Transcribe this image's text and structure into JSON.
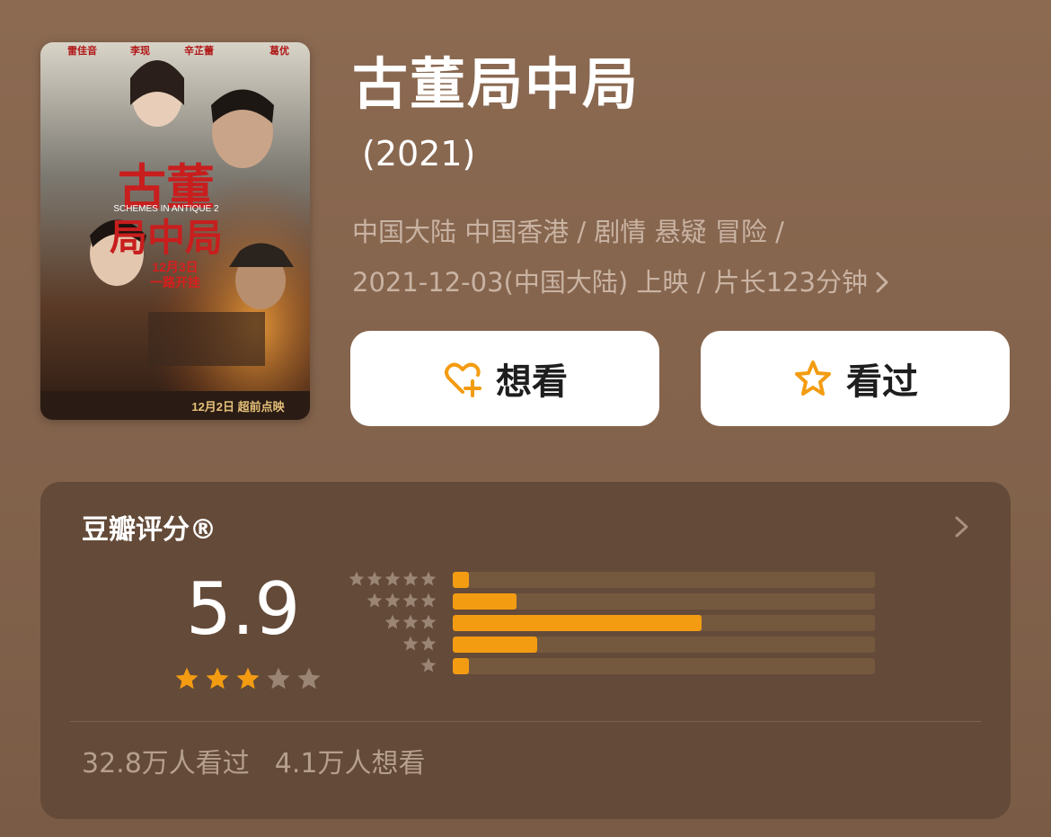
{
  "movie": {
    "title": "古董局中局",
    "year": "(2021)",
    "meta_line1": "中国大陆 中国香港 / 剧情 悬疑 冒险 /",
    "meta_line2": "2021-12-03(中国大陆) 上映 / 片长123分钟",
    "poster": {
      "title_text": "古董局中局",
      "english_subtitle": "SCHEMES IN ANTIQUE",
      "cast": [
        "雷佳音",
        "李现",
        "辛芷蕾",
        "葛优"
      ],
      "release_note": "12月3日 一路开挂",
      "preview_note": "12月2日 超前点映"
    }
  },
  "actions": {
    "want_label": "想看",
    "seen_label": "看过"
  },
  "rating": {
    "section_title": "豆瓣评分®",
    "score": "5.9",
    "star_rating": 3,
    "star_max": 5,
    "distribution": [
      {
        "stars": 5,
        "fraction": 0.035
      },
      {
        "stars": 4,
        "fraction": 0.15
      },
      {
        "stars": 3,
        "fraction": 0.59
      },
      {
        "stars": 2,
        "fraction": 0.2
      },
      {
        "stars": 1,
        "fraction": 0.035
      }
    ],
    "seen_count": "32.8万人看过",
    "want_count": "4.1万人想看"
  },
  "colors": {
    "background": "#8c6a52",
    "card": "#644a38",
    "accent_star": "#f39c12",
    "muted_text": "#c9b3a3"
  },
  "icons": {
    "want": "heart-plus-icon",
    "seen": "star-outline-icon",
    "detail": "chevron-right-icon"
  }
}
